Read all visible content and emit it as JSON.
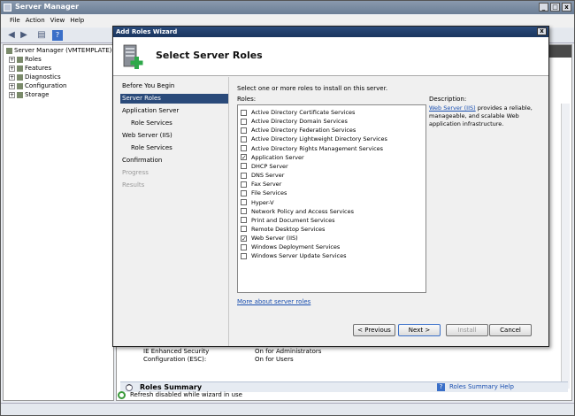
{
  "server_manager": {
    "title": "Server Manager",
    "menu": [
      "File",
      "Action",
      "View",
      "Help"
    ],
    "window_buttons": [
      "_",
      "□",
      "x"
    ],
    "tree": [
      {
        "label": "Server Manager (VMTEMPLATE)",
        "expander": ""
      },
      {
        "label": "Roles",
        "expander": "+"
      },
      {
        "label": "Features",
        "expander": "+"
      },
      {
        "label": "Diagnostics",
        "expander": "+"
      },
      {
        "label": "Configuration",
        "expander": "+"
      },
      {
        "label": "Storage",
        "expander": "+"
      }
    ],
    "esc_label": "IE Enhanced Security Configuration (ESC):",
    "esc_values": [
      "On for Administrators",
      "On for Users"
    ],
    "roles_summary_title": "Roles Summary",
    "roles_summary_help": "Roles Summary Help",
    "status": "Refresh disabled while wizard in use"
  },
  "wizard": {
    "title": "Add Roles Wizard",
    "close_label": "x",
    "header_title": "Select Server Roles",
    "nav": [
      {
        "label": "Before You Begin",
        "state": "normal",
        "sub": false
      },
      {
        "label": "Server Roles",
        "state": "active",
        "sub": false
      },
      {
        "label": "Application Server",
        "state": "normal",
        "sub": false
      },
      {
        "label": "Role Services",
        "state": "normal",
        "sub": true
      },
      {
        "label": "Web Server (IIS)",
        "state": "normal",
        "sub": false
      },
      {
        "label": "Role Services",
        "state": "normal",
        "sub": true
      },
      {
        "label": "Confirmation",
        "state": "normal",
        "sub": false
      },
      {
        "label": "Progress",
        "state": "disabled",
        "sub": false
      },
      {
        "label": "Results",
        "state": "disabled",
        "sub": false
      }
    ],
    "instructions": "Select one or more roles to install on this server.",
    "roles_label": "Roles:",
    "roles": [
      {
        "label": "Active Directory Certificate Services",
        "checked": false
      },
      {
        "label": "Active Directory Domain Services",
        "checked": false
      },
      {
        "label": "Active Directory Federation Services",
        "checked": false
      },
      {
        "label": "Active Directory Lightweight Directory Services",
        "checked": false
      },
      {
        "label": "Active Directory Rights Management Services",
        "checked": false
      },
      {
        "label": "Application Server",
        "checked": true
      },
      {
        "label": "DHCP Server",
        "checked": false
      },
      {
        "label": "DNS Server",
        "checked": false
      },
      {
        "label": "Fax Server",
        "checked": false
      },
      {
        "label": "File Services",
        "checked": false
      },
      {
        "label": "Hyper-V",
        "checked": false
      },
      {
        "label": "Network Policy and Access Services",
        "checked": false
      },
      {
        "label": "Print and Document Services",
        "checked": false
      },
      {
        "label": "Remote Desktop Services",
        "checked": false
      },
      {
        "label": "Web Server (IIS)",
        "checked": true
      },
      {
        "label": "Windows Deployment Services",
        "checked": false
      },
      {
        "label": "Windows Server Update Services",
        "checked": false
      }
    ],
    "description_label": "Description:",
    "description_link": "Web Server (IIS)",
    "description_text": " provides a reliable, manageable, and scalable Web application infrastructure.",
    "more_link": "More about server roles",
    "buttons": {
      "previous": "< Previous",
      "next": "Next >",
      "install": "Install",
      "cancel": "Cancel"
    }
  }
}
